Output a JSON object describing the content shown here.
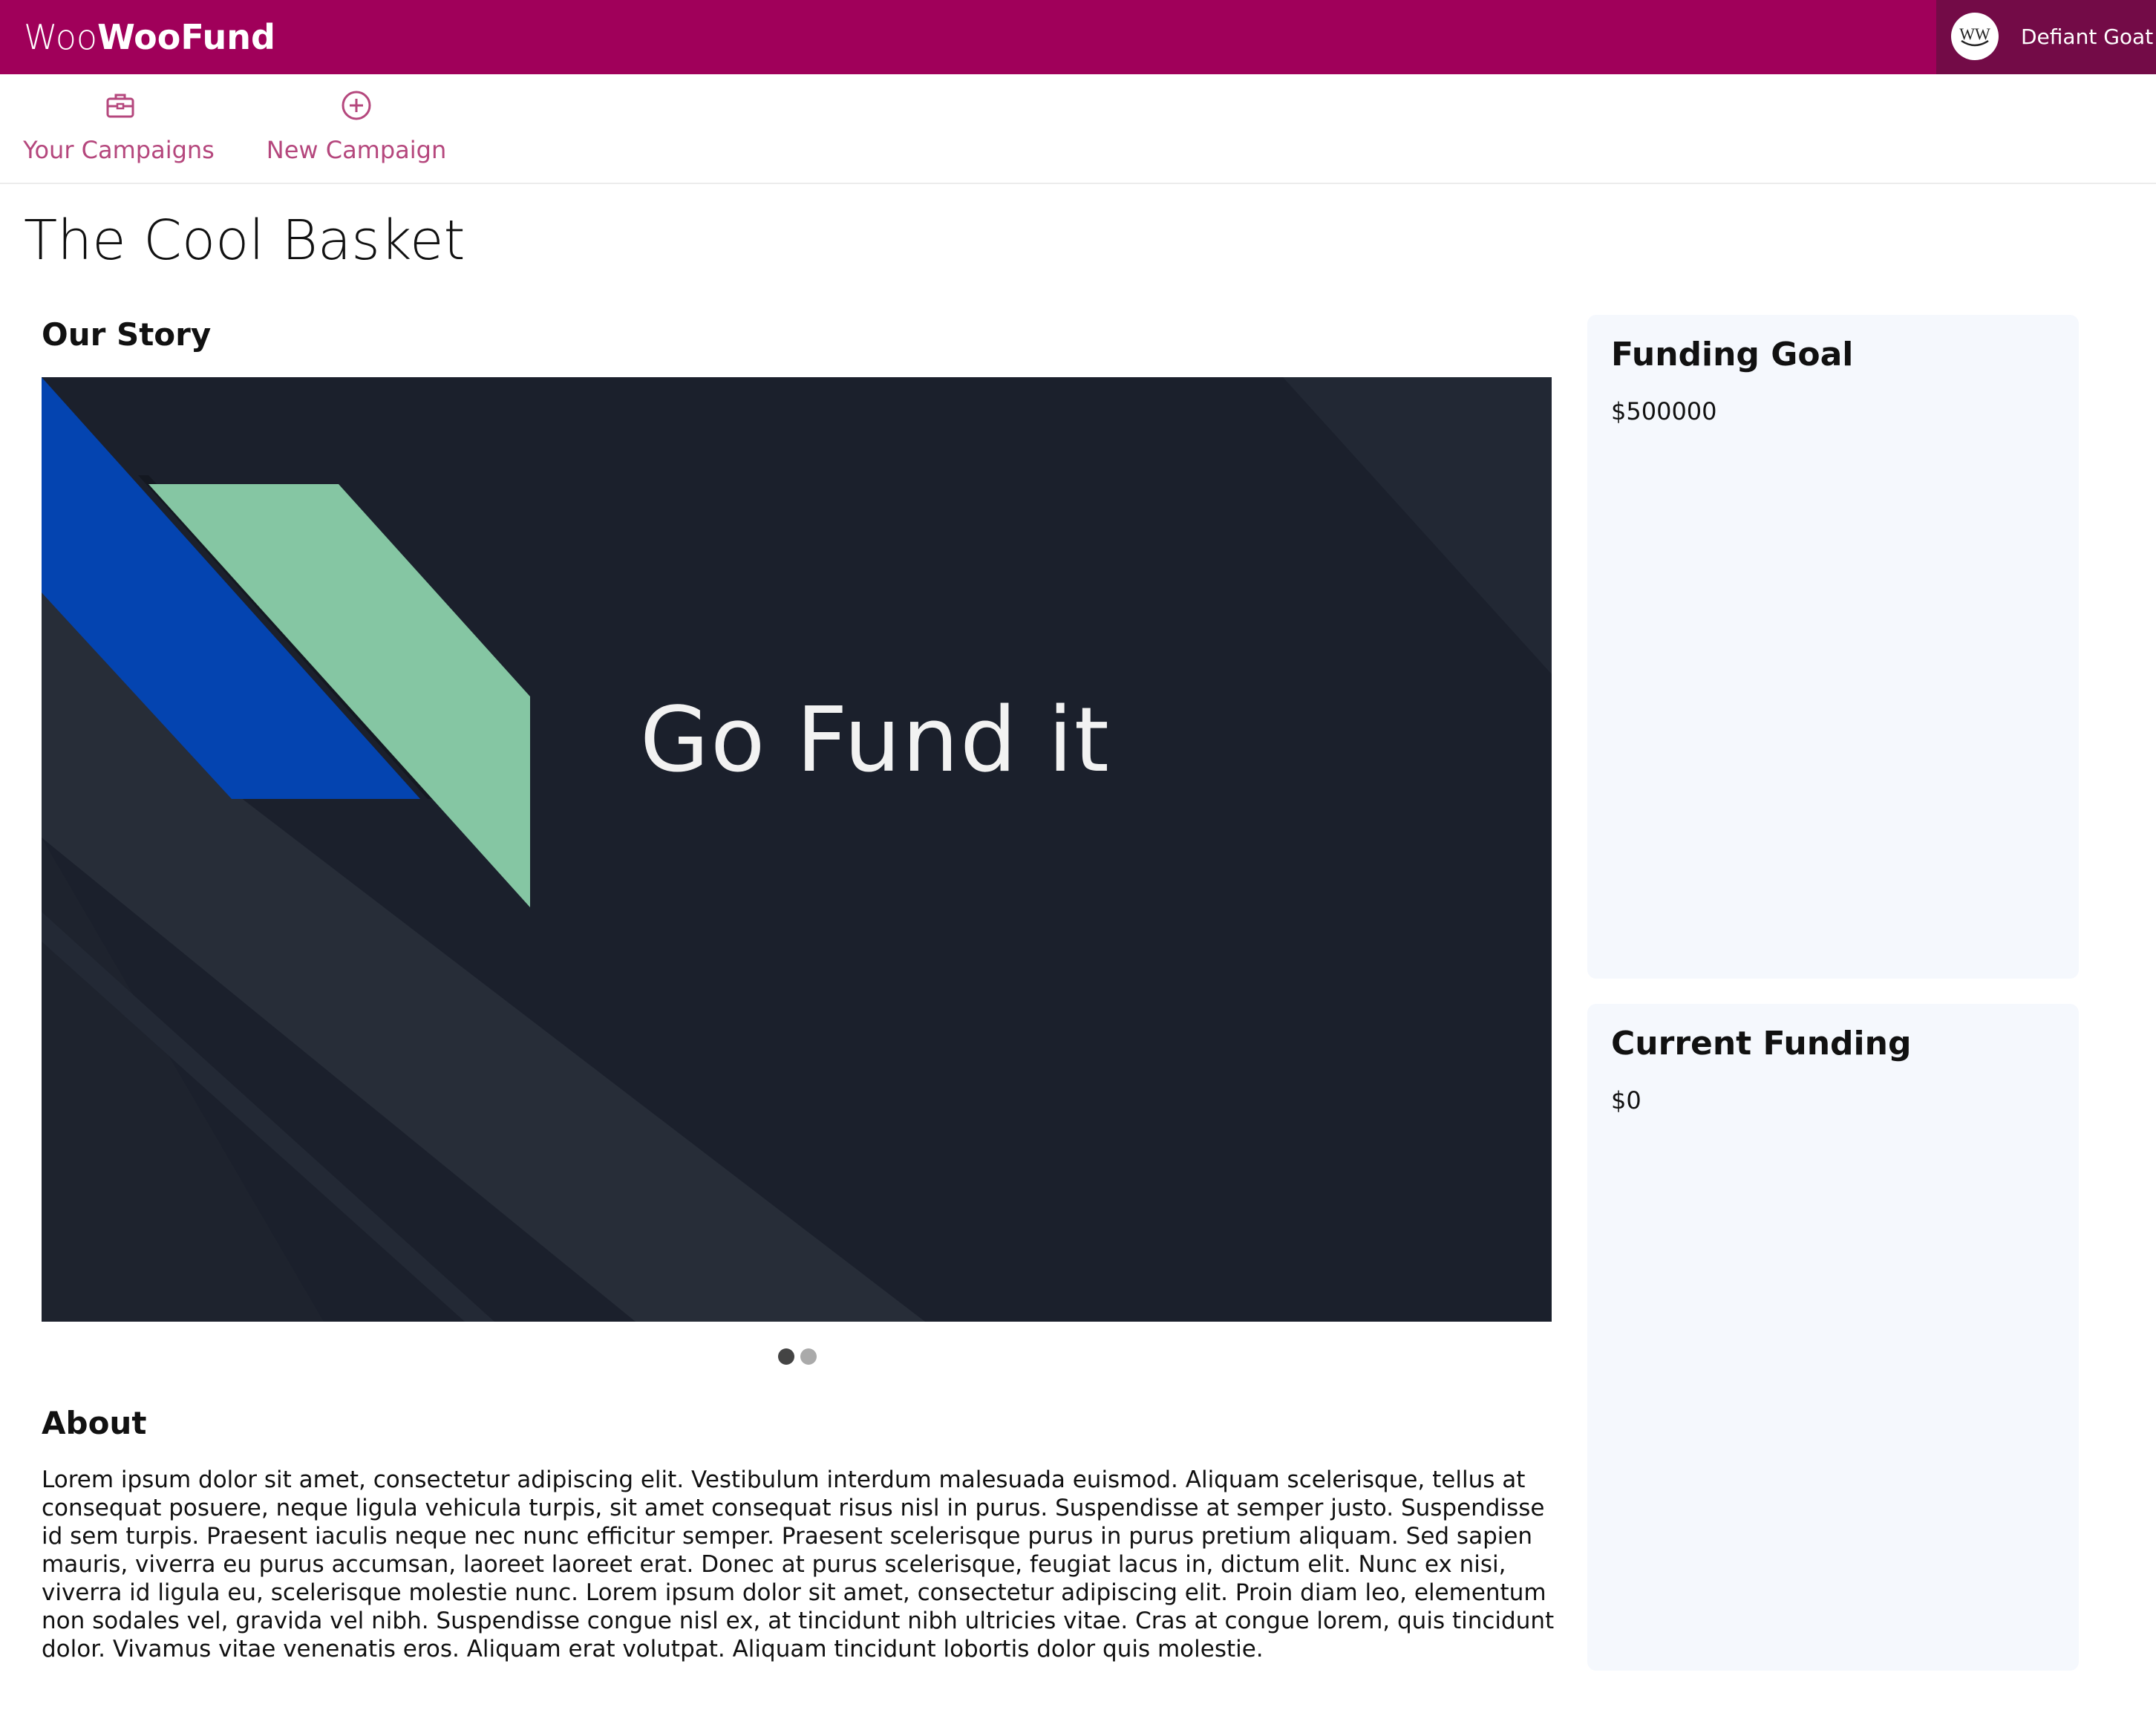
{
  "app": {
    "brand_light": "Woo",
    "brand_bold": "WooFund",
    "user_name": "Defiant Goat",
    "avatar_text": "WW"
  },
  "nav": {
    "items": [
      {
        "label": "Your Campaigns",
        "icon": "briefcase-icon"
      },
      {
        "label": "New Campaign",
        "icon": "plus-circle-icon"
      }
    ]
  },
  "campaign": {
    "title": "The Cool Basket",
    "story_heading": "Our Story",
    "slide_caption": "Go Fund it",
    "slides_total": 2,
    "active_slide": 1,
    "about_heading": "About",
    "about_text": "Lorem ipsum dolor sit amet, consectetur adipiscing elit. Vestibulum interdum malesuada euismod. Aliquam scelerisque, tellus at consequat posuere, neque ligula vehicula turpis, sit amet consequat risus nisl in purus. Suspendisse at semper justo. Suspendisse id sem turpis. Praesent iaculis neque nec nunc efficitur semper. Praesent scelerisque purus in purus pretium aliquam. Sed sapien mauris, viverra eu purus accumsan, laoreet laoreet erat. Donec at purus scelerisque, feugiat lacus in, dictum elit. Nunc ex nisi, viverra id ligula eu, scelerisque molestie nunc. Lorem ipsum dolor sit amet, consectetur adipiscing elit. Proin diam leo, elementum non sodales vel, gravida vel nibh. Suspendisse congue nisl ex, at tincidunt nibh ultricies vitae. Cras at congue lorem, quis tincidunt dolor. Vivamus vitae venenatis eros. Aliquam erat volutpat. Aliquam tincidunt lobortis dolor quis molestie."
  },
  "funding": {
    "goal_title": "Funding Goal",
    "goal_value": "$500000",
    "current_title": "Current Funding",
    "current_value": "$0"
  },
  "colors": {
    "brand": "#a0005a",
    "user_box": "#730b47",
    "nav_accent": "#b5477d",
    "card_bg": "#f5f8fd",
    "slide_bg": "#1b202c",
    "slide_blue": "#0444b0",
    "slide_green": "#85c6a3"
  }
}
